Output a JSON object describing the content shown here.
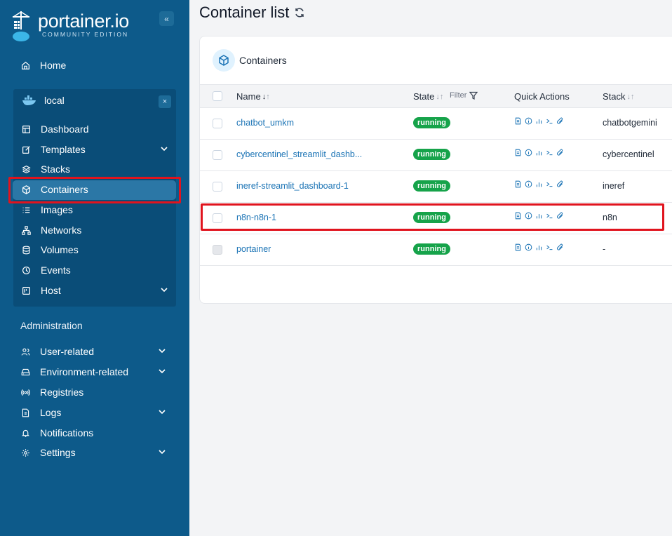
{
  "brand": {
    "name": "portainer.io",
    "subtitle": "COMMUNITY EDITION"
  },
  "sidebar": {
    "home": "Home",
    "environment": {
      "name": "local",
      "items": [
        {
          "label": "Dashboard",
          "icon": "dashboard-icon"
        },
        {
          "label": "Templates",
          "icon": "edit-icon",
          "expandable": true
        },
        {
          "label": "Stacks",
          "icon": "layers-icon"
        },
        {
          "label": "Containers",
          "icon": "cube-icon",
          "active": true
        },
        {
          "label": "Images",
          "icon": "list-icon"
        },
        {
          "label": "Networks",
          "icon": "network-icon"
        },
        {
          "label": "Volumes",
          "icon": "database-icon"
        },
        {
          "label": "Events",
          "icon": "clock-icon"
        },
        {
          "label": "Host",
          "icon": "server-icon",
          "expandable": true
        }
      ]
    },
    "administration_label": "Administration",
    "admin_items": [
      {
        "label": "User-related",
        "icon": "users-icon",
        "expandable": true
      },
      {
        "label": "Environment-related",
        "icon": "drive-icon",
        "expandable": true
      },
      {
        "label": "Registries",
        "icon": "radio-icon"
      },
      {
        "label": "Logs",
        "icon": "file-icon",
        "expandable": true
      },
      {
        "label": "Notifications",
        "icon": "bell-icon"
      },
      {
        "label": "Settings",
        "icon": "gear-icon",
        "expandable": true
      }
    ]
  },
  "page": {
    "title": "Container list"
  },
  "card": {
    "title": "Containers",
    "columns": {
      "name": "Name",
      "state": "State",
      "filter": "Filter",
      "quick_actions": "Quick Actions",
      "stack": "Stack"
    },
    "rows": [
      {
        "name": "chatbot_umkm",
        "state": "running",
        "stack": "chatbotgemini"
      },
      {
        "name": "cybercentinel_streamlit_dashb...",
        "state": "running",
        "stack": "cybercentinel"
      },
      {
        "name": "ineref-streamlit_dashboard-1",
        "state": "running",
        "stack": "ineref"
      },
      {
        "name": "n8n-n8n-1",
        "state": "running",
        "stack": "n8n"
      },
      {
        "name": "portainer",
        "state": "running",
        "stack": "-"
      }
    ]
  },
  "colors": {
    "sidebar": "#0d5a8a",
    "accent": "#1a73b5",
    "running": "#16a34a",
    "highlight": "#e0141e"
  }
}
